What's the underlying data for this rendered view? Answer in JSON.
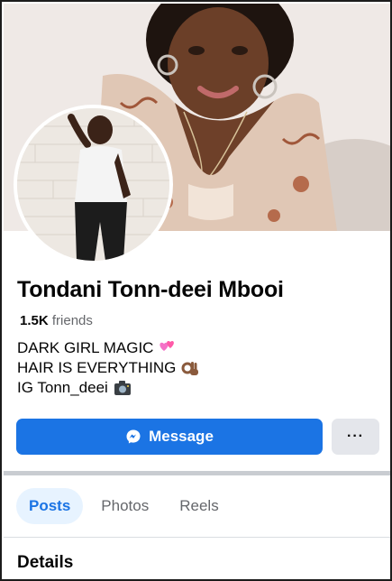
{
  "profile": {
    "name": "Tondani Tonn-deei Mbooi",
    "friends_count": "1.5K",
    "friends_label": "friends"
  },
  "bio": {
    "line1": "DARK GIRL MAGIC",
    "line1_icon": "heart-emoji-icon",
    "line2": "HAIR IS EVERYTHING",
    "line2_icon": "ok-hand-emoji-icon",
    "line3": "IG Tonn_deei",
    "line3_icon": "camera-emoji-icon"
  },
  "actions": {
    "message_label": "Message",
    "message_icon": "messenger-icon",
    "more_label": "···"
  },
  "tabs": [
    {
      "label": "Posts",
      "active": true
    },
    {
      "label": "Photos",
      "active": false
    },
    {
      "label": "Reels",
      "active": false
    }
  ],
  "section": {
    "details_title": "Details"
  },
  "colors": {
    "accent": "#1b74e4",
    "secondary_button": "#e4e6eb",
    "muted_text": "#65676b"
  }
}
